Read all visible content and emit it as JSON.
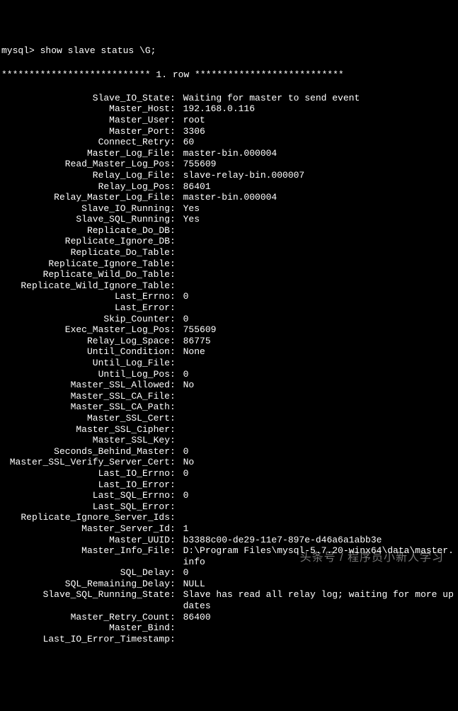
{
  "prompt": "mysql> show slave status \\G;",
  "header": "*************************** 1. row ***************************",
  "rows": [
    {
      "label": "Slave_IO_State",
      "value": "Waiting for master to send event"
    },
    {
      "label": "Master_Host",
      "value": "192.168.0.116"
    },
    {
      "label": "Master_User",
      "value": "root"
    },
    {
      "label": "Master_Port",
      "value": "3306"
    },
    {
      "label": "Connect_Retry",
      "value": "60"
    },
    {
      "label": "Master_Log_File",
      "value": "master-bin.000004"
    },
    {
      "label": "Read_Master_Log_Pos",
      "value": "755609"
    },
    {
      "label": "Relay_Log_File",
      "value": "slave-relay-bin.000007"
    },
    {
      "label": "Relay_Log_Pos",
      "value": "86401"
    },
    {
      "label": "Relay_Master_Log_File",
      "value": "master-bin.000004"
    },
    {
      "label": "Slave_IO_Running",
      "value": "Yes"
    },
    {
      "label": "Slave_SQL_Running",
      "value": "Yes"
    },
    {
      "label": "Replicate_Do_DB",
      "value": ""
    },
    {
      "label": "Replicate_Ignore_DB",
      "value": ""
    },
    {
      "label": "Replicate_Do_Table",
      "value": ""
    },
    {
      "label": "Replicate_Ignore_Table",
      "value": ""
    },
    {
      "label": "Replicate_Wild_Do_Table",
      "value": ""
    },
    {
      "label": "Replicate_Wild_Ignore_Table",
      "value": ""
    },
    {
      "label": "Last_Errno",
      "value": "0"
    },
    {
      "label": "Last_Error",
      "value": ""
    },
    {
      "label": "Skip_Counter",
      "value": "0"
    },
    {
      "label": "Exec_Master_Log_Pos",
      "value": "755609"
    },
    {
      "label": "Relay_Log_Space",
      "value": "86775"
    },
    {
      "label": "Until_Condition",
      "value": "None"
    },
    {
      "label": "Until_Log_File",
      "value": ""
    },
    {
      "label": "Until_Log_Pos",
      "value": "0"
    },
    {
      "label": "Master_SSL_Allowed",
      "value": "No"
    },
    {
      "label": "Master_SSL_CA_File",
      "value": ""
    },
    {
      "label": "Master_SSL_CA_Path",
      "value": ""
    },
    {
      "label": "Master_SSL_Cert",
      "value": ""
    },
    {
      "label": "Master_SSL_Cipher",
      "value": ""
    },
    {
      "label": "Master_SSL_Key",
      "value": ""
    },
    {
      "label": "Seconds_Behind_Master",
      "value": "0"
    },
    {
      "label": "Master_SSL_Verify_Server_Cert",
      "value": "No"
    },
    {
      "label": "Last_IO_Errno",
      "value": "0"
    },
    {
      "label": "Last_IO_Error",
      "value": ""
    },
    {
      "label": "Last_SQL_Errno",
      "value": "0"
    },
    {
      "label": "Last_SQL_Error",
      "value": ""
    },
    {
      "label": "Replicate_Ignore_Server_Ids",
      "value": ""
    },
    {
      "label": "Master_Server_Id",
      "value": "1"
    },
    {
      "label": "Master_UUID",
      "value": "b3388c00-de29-11e7-897e-d46a6a1abb3e"
    },
    {
      "label": "Master_Info_File",
      "value": "D:\\Program Files\\mysql-5.7.20-winx64\\data\\master.info"
    },
    {
      "label": "SQL_Delay",
      "value": "0"
    },
    {
      "label": "SQL_Remaining_Delay",
      "value": "NULL"
    },
    {
      "label": "Slave_SQL_Running_State",
      "value": "Slave has read all relay log; waiting for more updates"
    },
    {
      "label": "Master_Retry_Count",
      "value": "86400"
    },
    {
      "label": "Master_Bind",
      "value": ""
    },
    {
      "label": "Last_IO_Error_Timestamp",
      "value": ""
    }
  ],
  "watermark": "头条号 / 程序员小新人学习"
}
